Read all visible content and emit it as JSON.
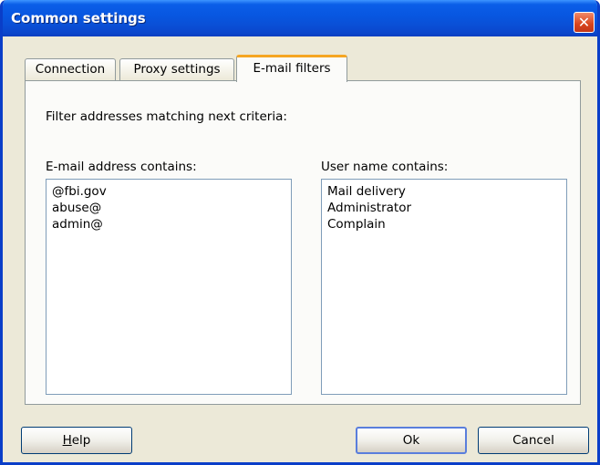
{
  "window": {
    "title": "Common settings",
    "close_symbol": "✕"
  },
  "tabs": [
    {
      "label": "Connection",
      "active": false
    },
    {
      "label": "Proxy settings",
      "active": false
    },
    {
      "label": "E-mail filters",
      "active": true
    }
  ],
  "filters": {
    "intro": "Filter addresses matching next criteria:",
    "email_label": "E-mail address contains:",
    "email_items": [
      "@fbi.gov",
      "abuse@",
      "admin@"
    ],
    "user_label": "User name contains:",
    "user_items": [
      "Mail delivery",
      "Administrator",
      "Complain"
    ]
  },
  "buttons": {
    "help": "Help",
    "help_access_key": "H",
    "ok": "Ok",
    "cancel": "Cancel"
  },
  "colors": {
    "title_bar": "#0a5ee8",
    "dialog_bg": "#ece9d8",
    "active_tab_accent": "#f5a623",
    "close_button": "#d8441c"
  },
  "icons": {
    "close": "close-icon"
  }
}
